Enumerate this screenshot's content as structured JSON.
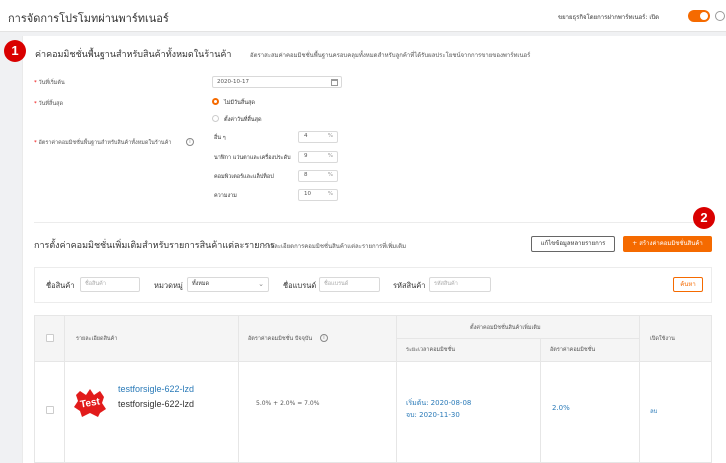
{
  "header": {
    "title": "การจัดการโปรโมทผ่านพาร์ทเนอร์",
    "toggle_label": "ขยายธุรกิจโดยการฝากพาร์ทเนอร์: เปิด"
  },
  "badges": {
    "one": "1",
    "two": "2"
  },
  "base_section": {
    "title": "ค่าคอมมิชชั่นพื้นฐานสำหรับสินค้าทั้งหมดในร้านค้า",
    "hint": "อัตราสะสมค่าคอมมิชชั่นพื้นฐานครอบคลุมทั้งหมดสำหรับลูกค้าที่ได้รับผลประโยชน์จากการขายของพาร์ทเนอร์",
    "start_label": "วันที่เริ่มต้น",
    "start_value": "2020-10-17",
    "end_label": "วันที่สิ้นสุด",
    "end_options": [
      "ไม่มีวันสิ้นสุด",
      "ตั้งค่าวันที่สิ้นสุด"
    ],
    "rate_label": "อัตราค่าคอมมิชชั่นพื้นฐานสำหรับสินค้าทั้งหมดในร้านค้า",
    "rates": [
      {
        "label": "อื่น ๆ",
        "value": "4",
        "unit": "%"
      },
      {
        "label": "นาฬิกา แว่นตาและเครื่องประดับ",
        "value": "9",
        "unit": "%"
      },
      {
        "label": "คอมพิวเตอร์และแล็ปท็อป",
        "value": "8",
        "unit": "%"
      },
      {
        "label": "ความงาม",
        "value": "10",
        "unit": "%"
      }
    ]
  },
  "item_section": {
    "title": "การตั้งค่าคอมมิชชั่นเพิ่มเติมสำหรับรายการสินค้าแต่ละรายการ",
    "hint": "รายละเอียดการคอมมิชชั่นสินค้าแต่ละรายการที่เพิ่มเติม",
    "btn_edit": "แก้ไขข้อมูลหลายรายการ",
    "btn_create": "+ สร้างค่าคอมมิชชั่นสินค้า"
  },
  "filters": {
    "product_name_label": "ชื่อสินค้า",
    "product_name_placeholder": "ชื่อสินค้า",
    "category_label": "หมวดหมู่",
    "category_value": "ทั้งหมด",
    "brand_label": "ชื่อแบรนด์",
    "brand_placeholder": "ชื่อแบรนด์",
    "sku_label": "รหัสสินค้า",
    "sku_placeholder": "รหัสสินค้า",
    "search_label": "ค้นหา"
  },
  "table": {
    "col_product": "รายละเอียดสินค้า",
    "col_rate": "อัตราค่าคอมมิชชั่น ปัจจุบัน",
    "col_group": "ตั้งค่าคอมมิชชั่นสินค้าเพิ่มเติม",
    "col_period": "ระยะเวลาคอมมิชชั่น",
    "col_add_rate": "อัตราค่าคอมมิชชั่น",
    "col_action": "เปิดใช้งาน",
    "rows": [
      {
        "name_link": "testforsigle-622-lzd",
        "name": "testforsigle-622-lzd",
        "rate_formula": "5.0% + 2.0% = 7.0%",
        "start": "เริ่มต้น: 2020-08-08",
        "end": "จบ: 2020-11-30",
        "add_rate": "2.0%",
        "action": "ลบ"
      }
    ]
  },
  "colors": {
    "accent": "#f56a00",
    "badge": "#d90000",
    "link": "#2a7ab8"
  }
}
